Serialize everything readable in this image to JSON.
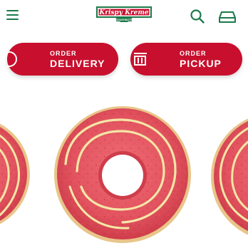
{
  "header": {
    "menu_icon": "hamburger-menu-icon",
    "logo": {
      "main": "Krispy Kreme",
      "sub": "DOUGHNUTS"
    },
    "search_icon": "search-icon",
    "bag_icon": "order-tray-icon"
  },
  "order_delivery": {
    "small_label": "ORDER",
    "big_label": "DELIVERY",
    "icon": "delivery-car-icon"
  },
  "order_pickup": {
    "small_label": "ORDER",
    "big_label": "PICKUP",
    "icon": "store-pickup-icon"
  },
  "colors": {
    "brand_green": "#1c7a4a",
    "brand_red": "#c8102e",
    "donut_glaze": "#e2535f",
    "drizzle": "#f3e6a6"
  }
}
